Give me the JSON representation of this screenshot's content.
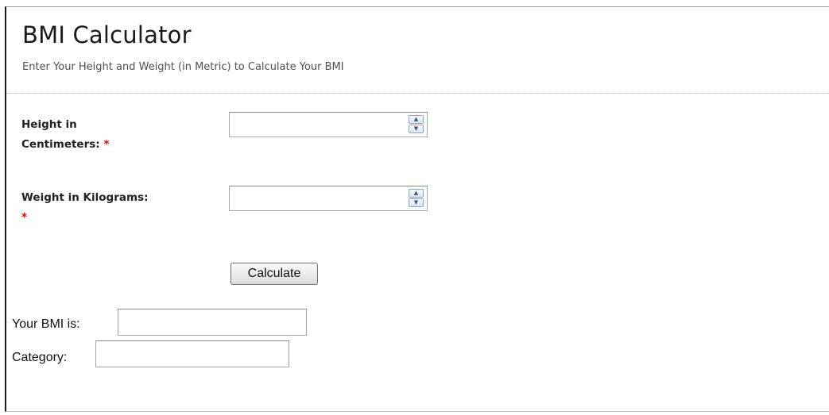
{
  "header": {
    "title": "BMI Calculator",
    "subtitle": "Enter Your Height and Weight (in Metric) to Calculate Your BMI"
  },
  "form": {
    "height": {
      "label_line1": "Height in",
      "label_line2": "Centimeters:",
      "required_mark": "*",
      "value": ""
    },
    "weight": {
      "label": "Weight in Kilograms:",
      "required_mark": "*",
      "value": ""
    },
    "spin_up_glyph": "▲",
    "spin_down_glyph": "▼",
    "calculate_label": "Calculate"
  },
  "results": {
    "bmi_label": "Your BMI is:",
    "bmi_value": "",
    "category_label": "Category:",
    "category_value": ""
  },
  "colors": {
    "required": "#ee0000",
    "title": "#1a1a1a",
    "subtitle": "#505050"
  }
}
